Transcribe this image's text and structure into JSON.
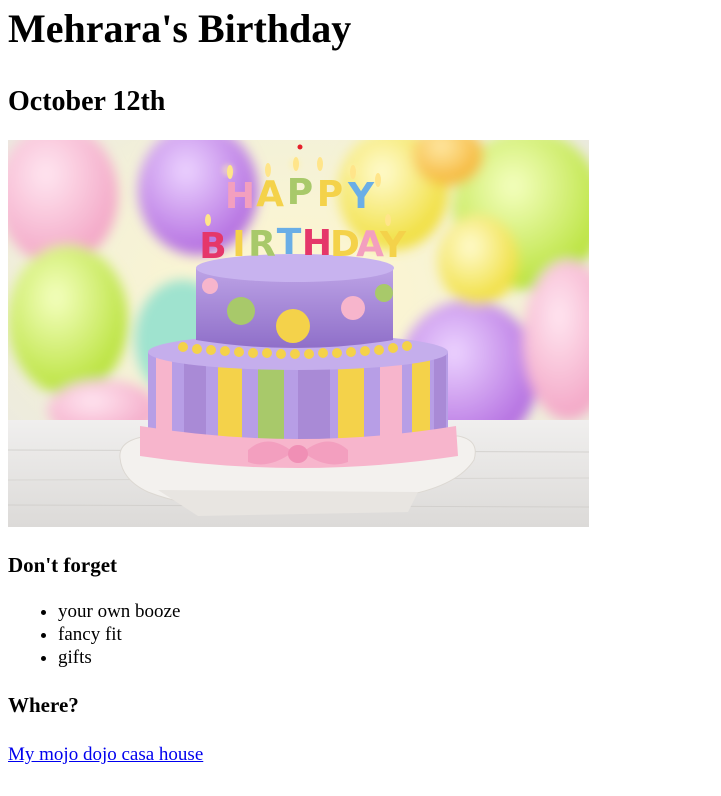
{
  "page": {
    "title": "Mehrara's Birthday",
    "date": "October 12th"
  },
  "image": {
    "alt": "Two-tier birthday cake with Happy Birthday candles",
    "candle_letters_top": [
      "H",
      "A",
      "P",
      "P",
      "Y"
    ],
    "candle_letters_bottom": [
      "B",
      "I",
      "R",
      "T",
      "H",
      "D",
      "A",
      "Y"
    ],
    "colors": {
      "purple": "#a98ad6",
      "yellow": "#f4d24a",
      "pink": "#f7b5cc",
      "green": "#a8c96a"
    }
  },
  "reminders": {
    "heading": "Don't forget",
    "items": [
      "your own booze",
      "fancy fit",
      "gifts"
    ]
  },
  "location": {
    "heading": "Where?",
    "link_text": "My mojo dojo casa house"
  }
}
